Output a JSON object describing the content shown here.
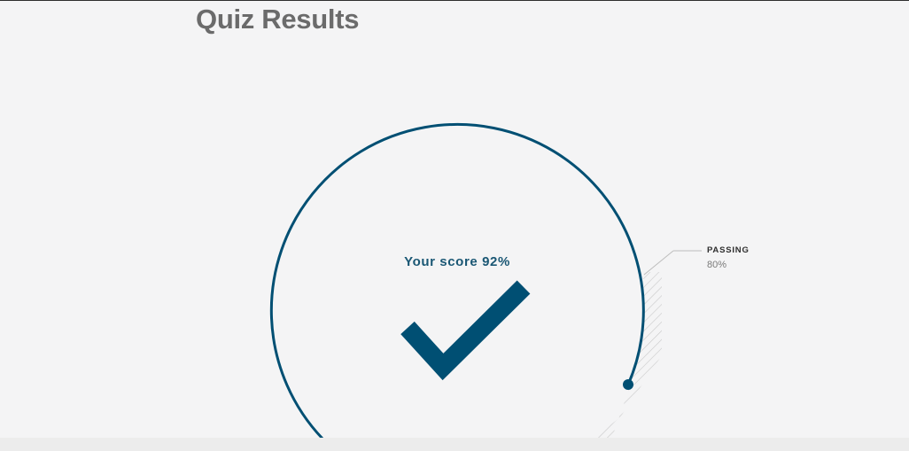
{
  "page": {
    "title": "Quiz Results"
  },
  "result": {
    "score_label": "Your score 92%",
    "score_percent": 92,
    "passed": true,
    "status_icon": "checkmark-icon"
  },
  "passing": {
    "label": "PASSING",
    "value": "80%",
    "threshold_percent": 80
  },
  "colors": {
    "accent": "#004f73",
    "background": "#f4f4f5",
    "title": "#6b6b6b",
    "hatch": "#c4c4c4"
  }
}
